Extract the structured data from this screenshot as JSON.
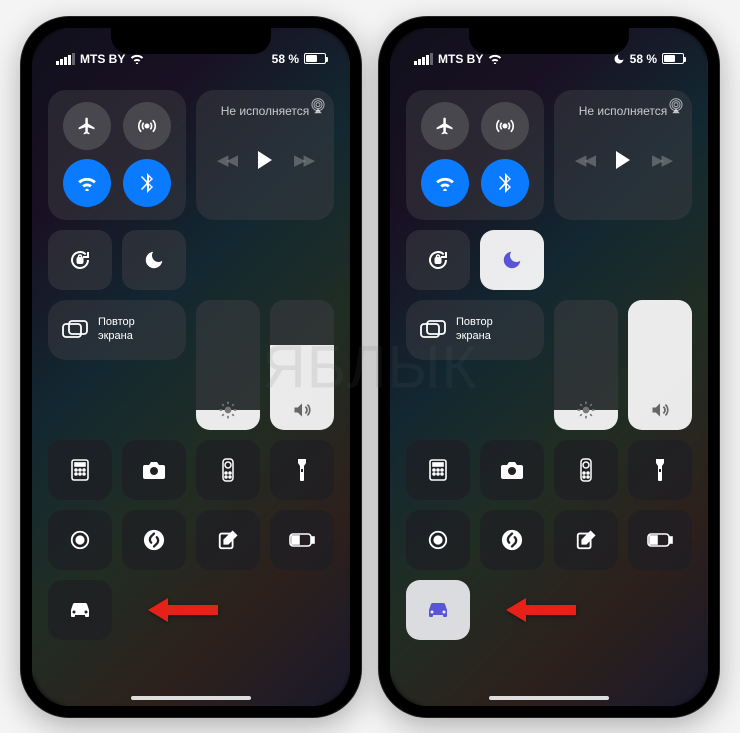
{
  "status": {
    "carrier": "MTS BY",
    "battery_percent": "58 %"
  },
  "media": {
    "now_playing": "Не исполняется"
  },
  "screen_mirroring": {
    "line1": "Повтор",
    "line2": "экрана"
  },
  "brightness_percent": 15,
  "volume_percent_left": 65,
  "volume_percent_right": 100,
  "watermark": "ЯБЛЫК",
  "left_phone": {
    "dnd_active": false,
    "dnd_moon_visible": false,
    "driving_active": false
  },
  "right_phone": {
    "dnd_active": true,
    "dnd_moon_visible": true,
    "driving_active": true
  }
}
